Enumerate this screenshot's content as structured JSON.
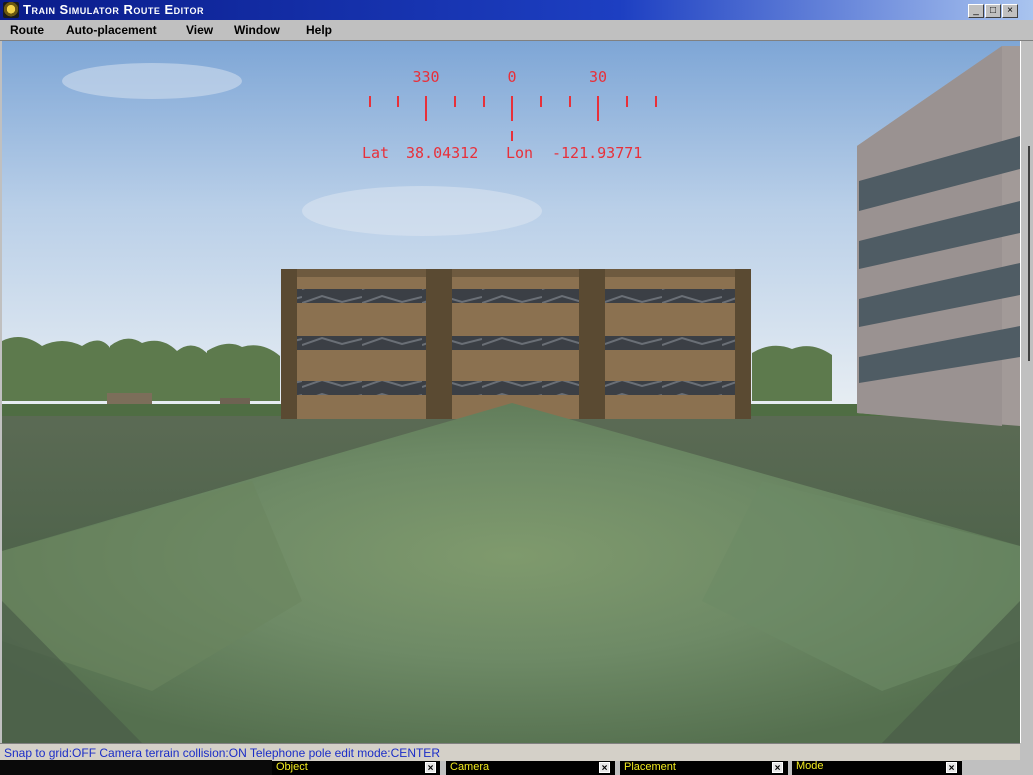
{
  "window": {
    "title": "Train Simulator Route Editor",
    "minimize": "_",
    "maximize": "□",
    "close": "×"
  },
  "menu": [
    {
      "label": "Route"
    },
    {
      "label": "Auto-placement"
    },
    {
      "label": "View"
    },
    {
      "label": "Window"
    },
    {
      "label": "Help"
    }
  ],
  "hud": {
    "compass_labels": [
      "330",
      "0",
      "30"
    ],
    "lat_label": "Lat",
    "lat_value": "38.04312",
    "lon_label": "Lon",
    "lon_value": "-121.93771",
    "color": "#e8303a"
  },
  "status": {
    "text": "Snap to grid:OFF Camera terrain collision:ON Telephone pole edit mode:CENTER"
  },
  "panels": [
    {
      "label": "Object",
      "close": "×"
    },
    {
      "label": "Camera",
      "close": "×"
    },
    {
      "label": "Placement",
      "close": "×"
    },
    {
      "label": "Mode",
      "close": "×"
    }
  ],
  "colors": {
    "title_gradient_start": "#0a1c8a",
    "status_text": "#1b2dc7",
    "panel_text": "#f2ea1f"
  }
}
